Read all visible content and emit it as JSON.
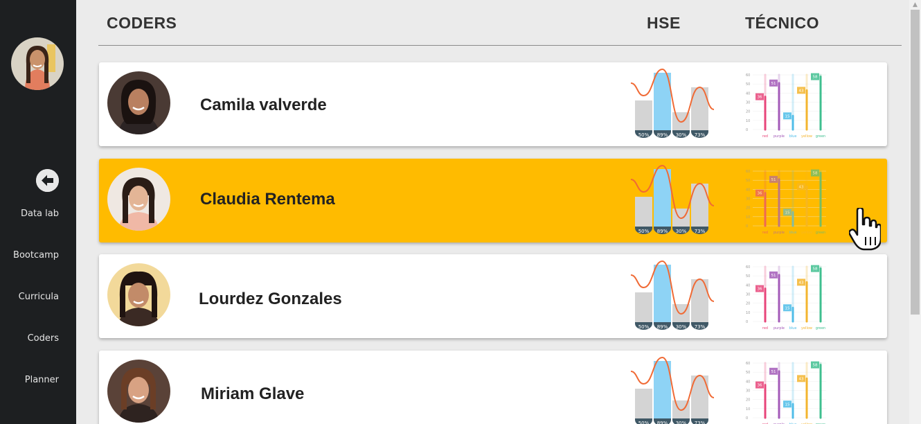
{
  "sidebar": {
    "nav": [
      {
        "label": "Data lab"
      },
      {
        "label": "Bootcamp"
      },
      {
        "label": "Curricula"
      },
      {
        "label": "Coders"
      },
      {
        "label": "Planner"
      }
    ]
  },
  "header": {
    "coders_label": "CODERS",
    "hse_label": "HSE",
    "tecnico_label": "TÉCNICO"
  },
  "hse_chart": {
    "bar_values": [
      50,
      89,
      30,
      73
    ],
    "bar_labels": [
      "50%",
      "89%",
      "30%",
      "73%"
    ],
    "bar_colors": [
      "#d4d4d4",
      "#8ed3f5",
      "#d4d4d4",
      "#d4d4d4"
    ],
    "line_color": "#f06a35",
    "badge_color": "#3f5866"
  },
  "tech_chart": {
    "y_ticks": [
      "60",
      "50",
      "40",
      "30",
      "20",
      "10",
      "0"
    ],
    "categories": [
      "red",
      "purple",
      "blue",
      "yellow",
      "green"
    ],
    "values": [
      36,
      51,
      15,
      43,
      58
    ],
    "colors": [
      "#e8457a",
      "#a35ab8",
      "#4fbde8",
      "#f3b52e",
      "#3fbf8f"
    ]
  },
  "coders": [
    {
      "name": "Camila valverde",
      "active": false
    },
    {
      "name": "Claudia Rentema",
      "active": true
    },
    {
      "name": "Lourdez Gonzales",
      "active": false
    },
    {
      "name": "Miriam Glave",
      "active": false
    }
  ],
  "colors": {
    "sidebar_bg": "#1d1f21",
    "page_bg": "#ebebeb",
    "active_card": "#ffbb00"
  }
}
